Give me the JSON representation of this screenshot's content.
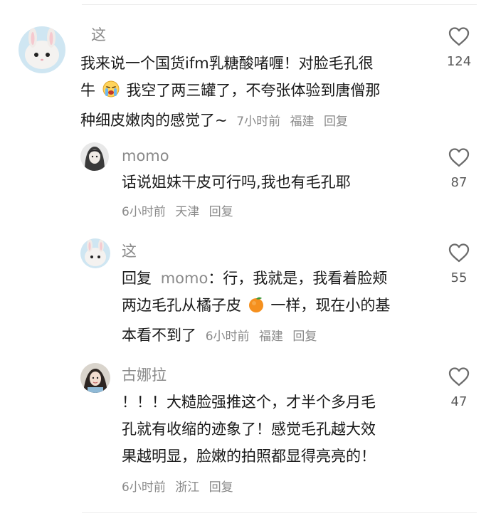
{
  "comments": [
    {
      "username": "这",
      "lines": [
        "我来说一个国货ifm乳糖酸啫喱！对脸毛孔很",
        "牛",
        "我空了两三罐了，不夸张体验到唐僧那",
        "种细皮嫩肉的感觉了~"
      ],
      "time": "7小时前",
      "location": "福建",
      "reply_label": "回复",
      "likes": "124",
      "emoji": "crying-face-emoji"
    },
    {
      "username": "momo",
      "lines": [
        "话说姐妹干皮可行吗,我也有毛孔耶"
      ],
      "time": "6小时前",
      "location": "天津",
      "reply_label": "回复",
      "likes": "87"
    },
    {
      "username": "这",
      "reply_prefix": "回复",
      "mention": "momo",
      "lines": [
        "：行，我就是，我看着脸颊",
        "两边毛孔从橘子皮",
        "一样，现在小的基",
        "本看不到了"
      ],
      "time": "6小时前",
      "location": "福建",
      "reply_label": "回复",
      "likes": "55",
      "emoji": "tangerine-emoji"
    },
    {
      "username": "古娜拉",
      "lines": [
        "！！！大糙脸强推这个，才半个多月毛",
        "孔就有收缩的迹象了！感觉毛孔越大效",
        "果越明显，脸嫩的拍照都显得亮亮的！"
      ],
      "time": "6小时前",
      "location": "浙江",
      "reply_label": "回复",
      "likes": "47"
    }
  ],
  "colors": {
    "text": "#1a1a1a",
    "muted": "#8a8a8a",
    "heart": "#6b6b6b"
  },
  "icons": {
    "like": "heart-outline-icon"
  }
}
